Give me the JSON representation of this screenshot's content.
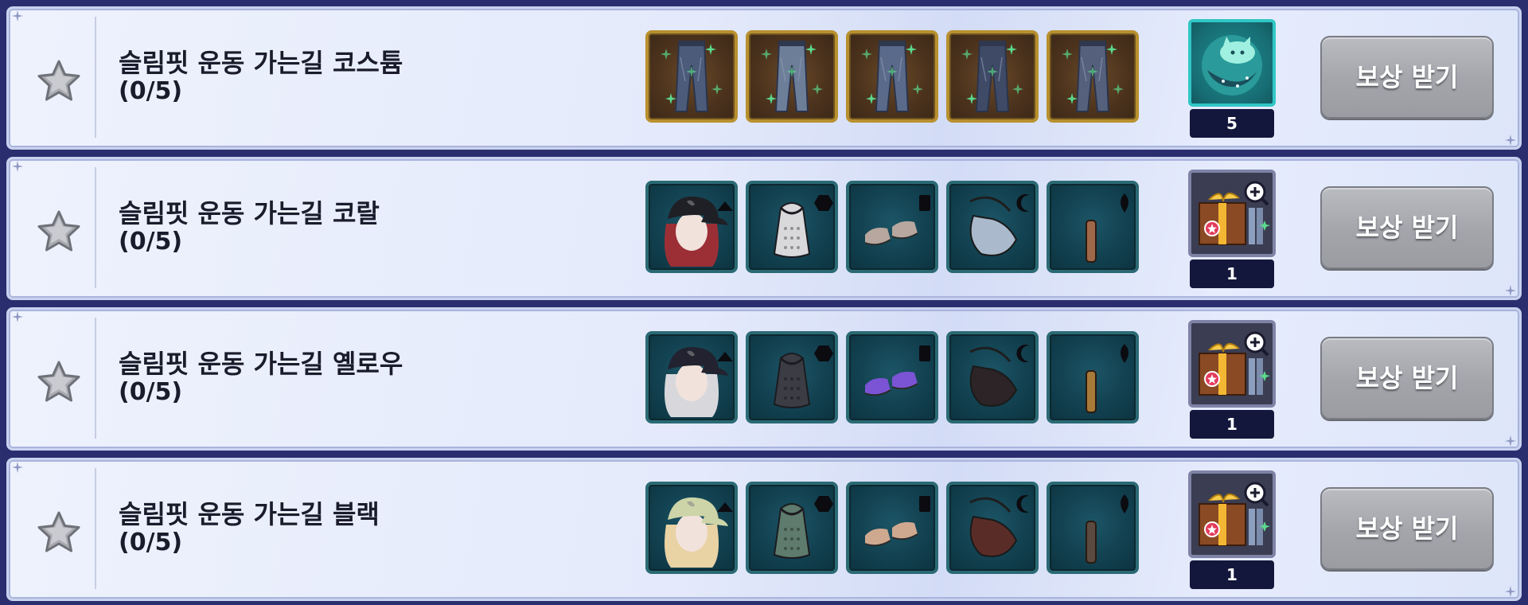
{
  "rows": [
    {
      "title": "슬림핏 운동 가는길 코스튬",
      "progress": "(0/5)",
      "slot_style": "gold",
      "items": [
        "jeans-icon",
        "jeans-icon",
        "jeans-icon",
        "jeans-icon",
        "jeans-icon"
      ],
      "reward_icon": "moon-cat-icon",
      "reward_count": "5",
      "button_label": "보상 받기"
    },
    {
      "title": "슬림핏 운동 가는길 코랄",
      "progress": "(0/5)",
      "slot_style": "teal",
      "items": [
        "cap-hair-icon",
        "top-icon",
        "shoes-icon",
        "bag-icon",
        "accessory-icon"
      ],
      "reward_icon": "gift-box-icon",
      "reward_count": "1",
      "button_label": "보상 받기"
    },
    {
      "title": "슬림핏 운동 가는길 옐로우",
      "progress": "(0/5)",
      "slot_style": "teal",
      "items": [
        "cap-hair-icon",
        "top-icon",
        "shoes-icon",
        "bag-icon",
        "accessory-icon"
      ],
      "reward_icon": "gift-box-icon",
      "reward_count": "1",
      "button_label": "보상 받기"
    },
    {
      "title": "슬림핏 운동 가는길 블랙",
      "progress": "(0/5)",
      "slot_style": "teal",
      "items": [
        "cap-hair-icon",
        "top-icon",
        "shoes-icon",
        "bag-icon",
        "accessory-icon"
      ],
      "reward_icon": "gift-box-icon",
      "reward_count": "1",
      "button_label": "보상 받기"
    }
  ],
  "colors": {
    "hair": [
      "#9b2f35",
      "#d8d8dc",
      "#e9d2a4"
    ],
    "cap": [
      "#1f2026",
      "#222230",
      "#cdd4a8"
    ],
    "top": [
      "#d9d9dc",
      "#3c3c44",
      "#5e7b6d"
    ],
    "shoes": [
      "#b7a79e",
      "#7a54d4",
      "#cfa890"
    ],
    "bag": [
      "#aab9cc",
      "#2c2426",
      "#5a2c28"
    ],
    "accessory": [
      "#a0684a",
      "#a77a3a",
      "#5a4a40"
    ]
  }
}
